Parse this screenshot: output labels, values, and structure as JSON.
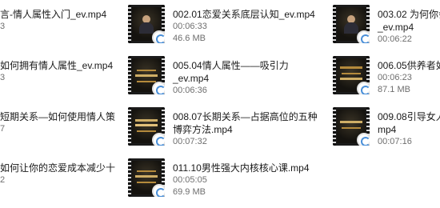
{
  "files": [
    {
      "name_lines": [
        "言-情人属性入门_ev.mp4"
      ],
      "duration": "3",
      "size": ""
    },
    {
      "name_lines": [
        "002.01恋爱关系底层认知_ev.mp4"
      ],
      "duration": "00:06:33",
      "size": "46.6 MB"
    },
    {
      "name_lines": [
        "003.02 为何你会",
        "_ev.mp4"
      ],
      "duration": "00:06:22",
      "size": ""
    },
    {
      "name_lines": [
        "如何拥有情人属性_ev.mp4"
      ],
      "duration": "3",
      "size": ""
    },
    {
      "name_lines": [
        "005.04情人属性——吸引力",
        "_ev.mp4"
      ],
      "duration": "00:06:36",
      "size": ""
    },
    {
      "name_lines": [
        "006.05供养者如"
      ],
      "duration": "00:06:23",
      "size": "87.1 MB"
    },
    {
      "name_lines": [
        "短期关系—如何使用情人策"
      ],
      "duration": "7",
      "size": ""
    },
    {
      "name_lines": [
        "008.07长期关系—占据高位的五种",
        "博弈方法.mp4"
      ],
      "duration": "00:07:32",
      "size": ""
    },
    {
      "name_lines": [
        "009.08引导女人",
        "mp4"
      ],
      "duration": "00:07:16",
      "size": ""
    },
    {
      "name_lines": [
        "如何让你的恋爱成本减少十"
      ],
      "duration": "2",
      "size": ""
    },
    {
      "name_lines": [
        "011.10男性强大内核核心课.mp4"
      ],
      "duration": "00:05:05",
      "size": "69.9 MB"
    }
  ]
}
